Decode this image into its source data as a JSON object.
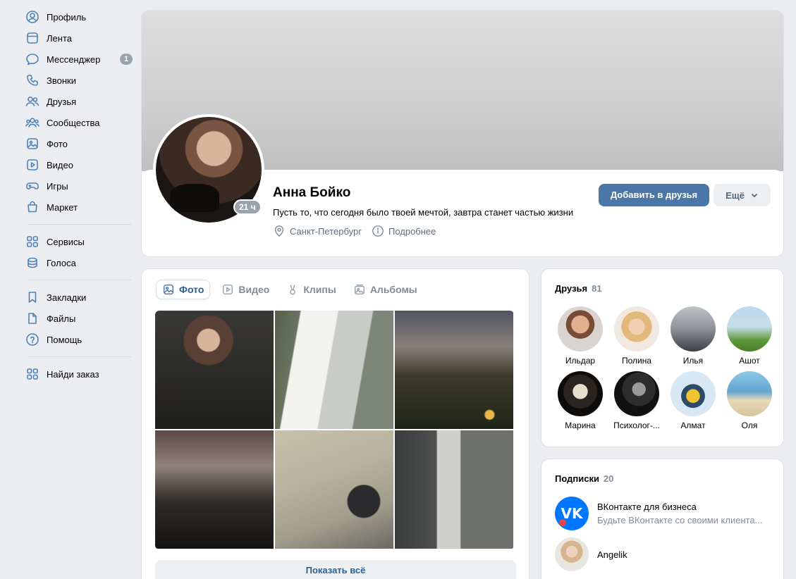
{
  "nav": {
    "items": [
      {
        "label": "Профиль",
        "icon": "profile-icon"
      },
      {
        "label": "Лента",
        "icon": "feed-icon"
      },
      {
        "label": "Мессенджер",
        "icon": "messenger-icon",
        "badge": "1"
      },
      {
        "label": "Звонки",
        "icon": "phone-icon"
      },
      {
        "label": "Друзья",
        "icon": "friends-icon"
      },
      {
        "label": "Сообщества",
        "icon": "communities-icon"
      },
      {
        "label": "Фото",
        "icon": "photo-icon"
      },
      {
        "label": "Видео",
        "icon": "video-icon"
      },
      {
        "label": "Игры",
        "icon": "gamepad-icon"
      },
      {
        "label": "Маркет",
        "icon": "market-icon"
      }
    ],
    "group2": [
      {
        "label": "Сервисы",
        "icon": "services-icon"
      },
      {
        "label": "Голоса",
        "icon": "votes-icon"
      }
    ],
    "group3": [
      {
        "label": "Закладки",
        "icon": "bookmark-icon"
      },
      {
        "label": "Файлы",
        "icon": "file-icon"
      },
      {
        "label": "Помощь",
        "icon": "help-icon"
      }
    ],
    "group4": [
      {
        "label": "Найди заказ",
        "icon": "find-order-icon"
      }
    ]
  },
  "profile": {
    "name": "Анна Бойко",
    "status": "Пусть то, что сегодня было твоей мечтой, завтра станет частью жизни",
    "online": "21 ч",
    "city": "Санкт-Петербург",
    "more_info": "Подробнее",
    "add_friend_label": "Добавить в друзья",
    "more_label": "Ещё"
  },
  "media": {
    "tabs": [
      {
        "label": "Фото",
        "icon": "photo-icon",
        "active": true
      },
      {
        "label": "Видео",
        "icon": "video-icon"
      },
      {
        "label": "Клипы",
        "icon": "clips-icon"
      },
      {
        "label": "Альбомы",
        "icon": "albums-icon"
      }
    ],
    "show_all": "Показать всё"
  },
  "friends": {
    "title": "Друзья",
    "count": "81",
    "list": [
      {
        "name": "Ильдар"
      },
      {
        "name": "Полина"
      },
      {
        "name": "Илья"
      },
      {
        "name": "Ашот"
      },
      {
        "name": "Марина"
      },
      {
        "name": "Психолог-..."
      },
      {
        "name": "Алмат"
      },
      {
        "name": "Оля"
      }
    ]
  },
  "subscriptions": {
    "title": "Подписки",
    "count": "20",
    "list": [
      {
        "name": "ВКонтакте для бизнеса",
        "desc": "Будьте ВКонтакте со своими клиента...",
        "logo_text": "VK"
      },
      {
        "name": "Angelik",
        "desc": ""
      }
    ]
  },
  "colors": {
    "accent": "#4a76a8",
    "link": "#2c5e92",
    "page_bg": "#ebedf0",
    "icon": "#5181b8"
  }
}
